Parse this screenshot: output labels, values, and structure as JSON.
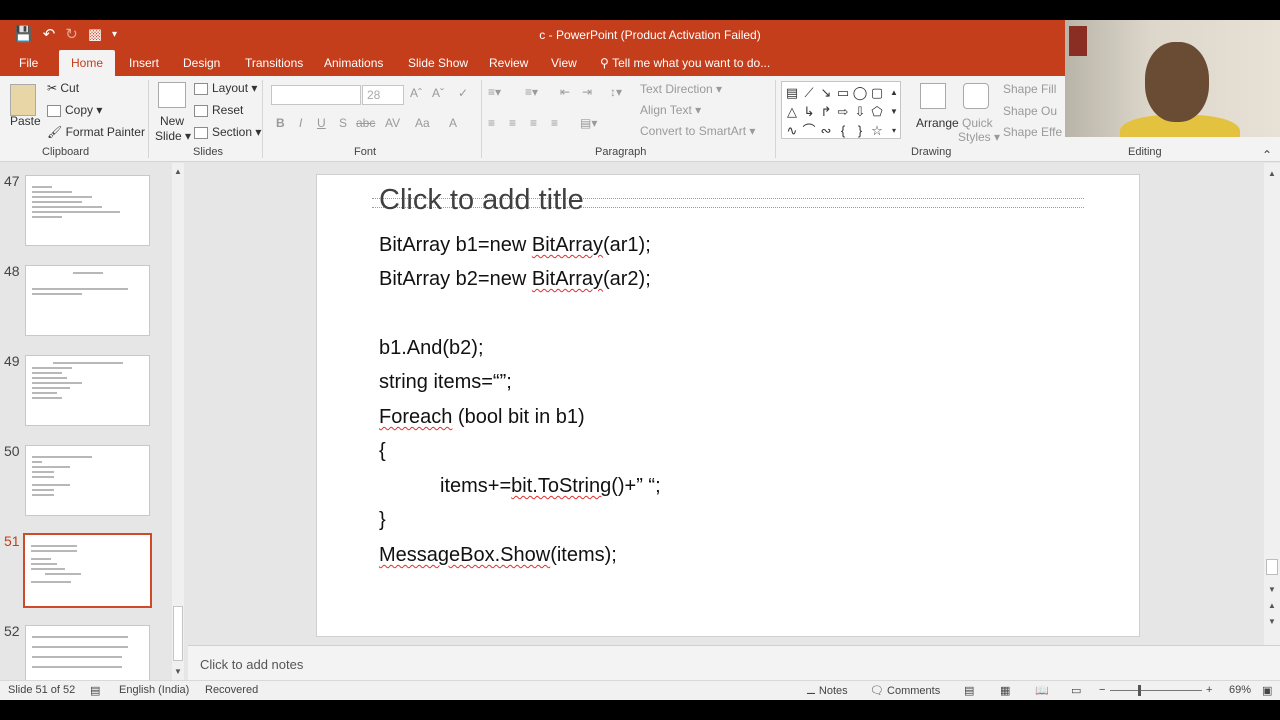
{
  "app": {
    "title": "c - PowerPoint (Product Activation Failed)",
    "qat_icons": [
      "save-icon",
      "undo-icon",
      "redo-icon",
      "present-icon",
      "customize-icon"
    ]
  },
  "tabs": [
    {
      "label": "File"
    },
    {
      "label": "Home"
    },
    {
      "label": "Insert"
    },
    {
      "label": "Design"
    },
    {
      "label": "Transitions"
    },
    {
      "label": "Animations"
    },
    {
      "label": "Slide Show"
    },
    {
      "label": "Review"
    },
    {
      "label": "View"
    }
  ],
  "tell_me": "Tell me what you want to do...",
  "ribbon": {
    "clipboard": {
      "paste": "Paste",
      "cut": "Cut",
      "copy": "Copy",
      "format_painter": "Format Painter",
      "label": "Clipboard"
    },
    "slides": {
      "new_slide": "New",
      "new_slide2": "Slide",
      "layout": "Layout",
      "reset": "Reset",
      "section": "Section",
      "label": "Slides"
    },
    "font": {
      "size": "28",
      "label": "Font",
      "bold": "B",
      "italic": "I",
      "underline": "U",
      "shadow": "S",
      "strike": "abc",
      "spacing": "AV",
      "case": "Aa",
      "color": "A"
    },
    "paragraph": {
      "text_direction": "Text Direction",
      "align_text": "Align Text",
      "convert_smartart": "Convert to SmartArt",
      "label": "Paragraph"
    },
    "drawing": {
      "arrange": "Arrange",
      "quick": "Quick",
      "styles": "Styles",
      "shape_fill": "Shape Fill",
      "shape_outline": "Shape Ou",
      "shape_effects": "Shape Effe",
      "label": "Drawing"
    },
    "editing": {
      "label": "Editing"
    }
  },
  "slides": [
    {
      "number": "47"
    },
    {
      "number": "48"
    },
    {
      "number": "49"
    },
    {
      "number": "50"
    },
    {
      "number": "51"
    },
    {
      "number": "52"
    }
  ],
  "slide": {
    "title": "Click to add title",
    "lines": [
      "BitArray b1=new BitArray(ar1);",
      "BitArray b2=new BitArray(ar2);",
      "b1.And(b2);",
      "string items=“”;",
      "Foreach (bool bit in b1)",
      "{",
      "items+=bit.ToString()+” “;",
      "}",
      "MessageBox.Show(items);"
    ]
  },
  "notes_placeholder": "Click to add notes",
  "status": {
    "slide_of": "Slide 51 of 52",
    "language": "English (India)",
    "recovered": "Recovered",
    "notes": "Notes",
    "comments": "Comments",
    "zoom": "69%"
  },
  "colors": {
    "accent": "#c43e1c",
    "selected_thumb": "#d04a2a"
  }
}
